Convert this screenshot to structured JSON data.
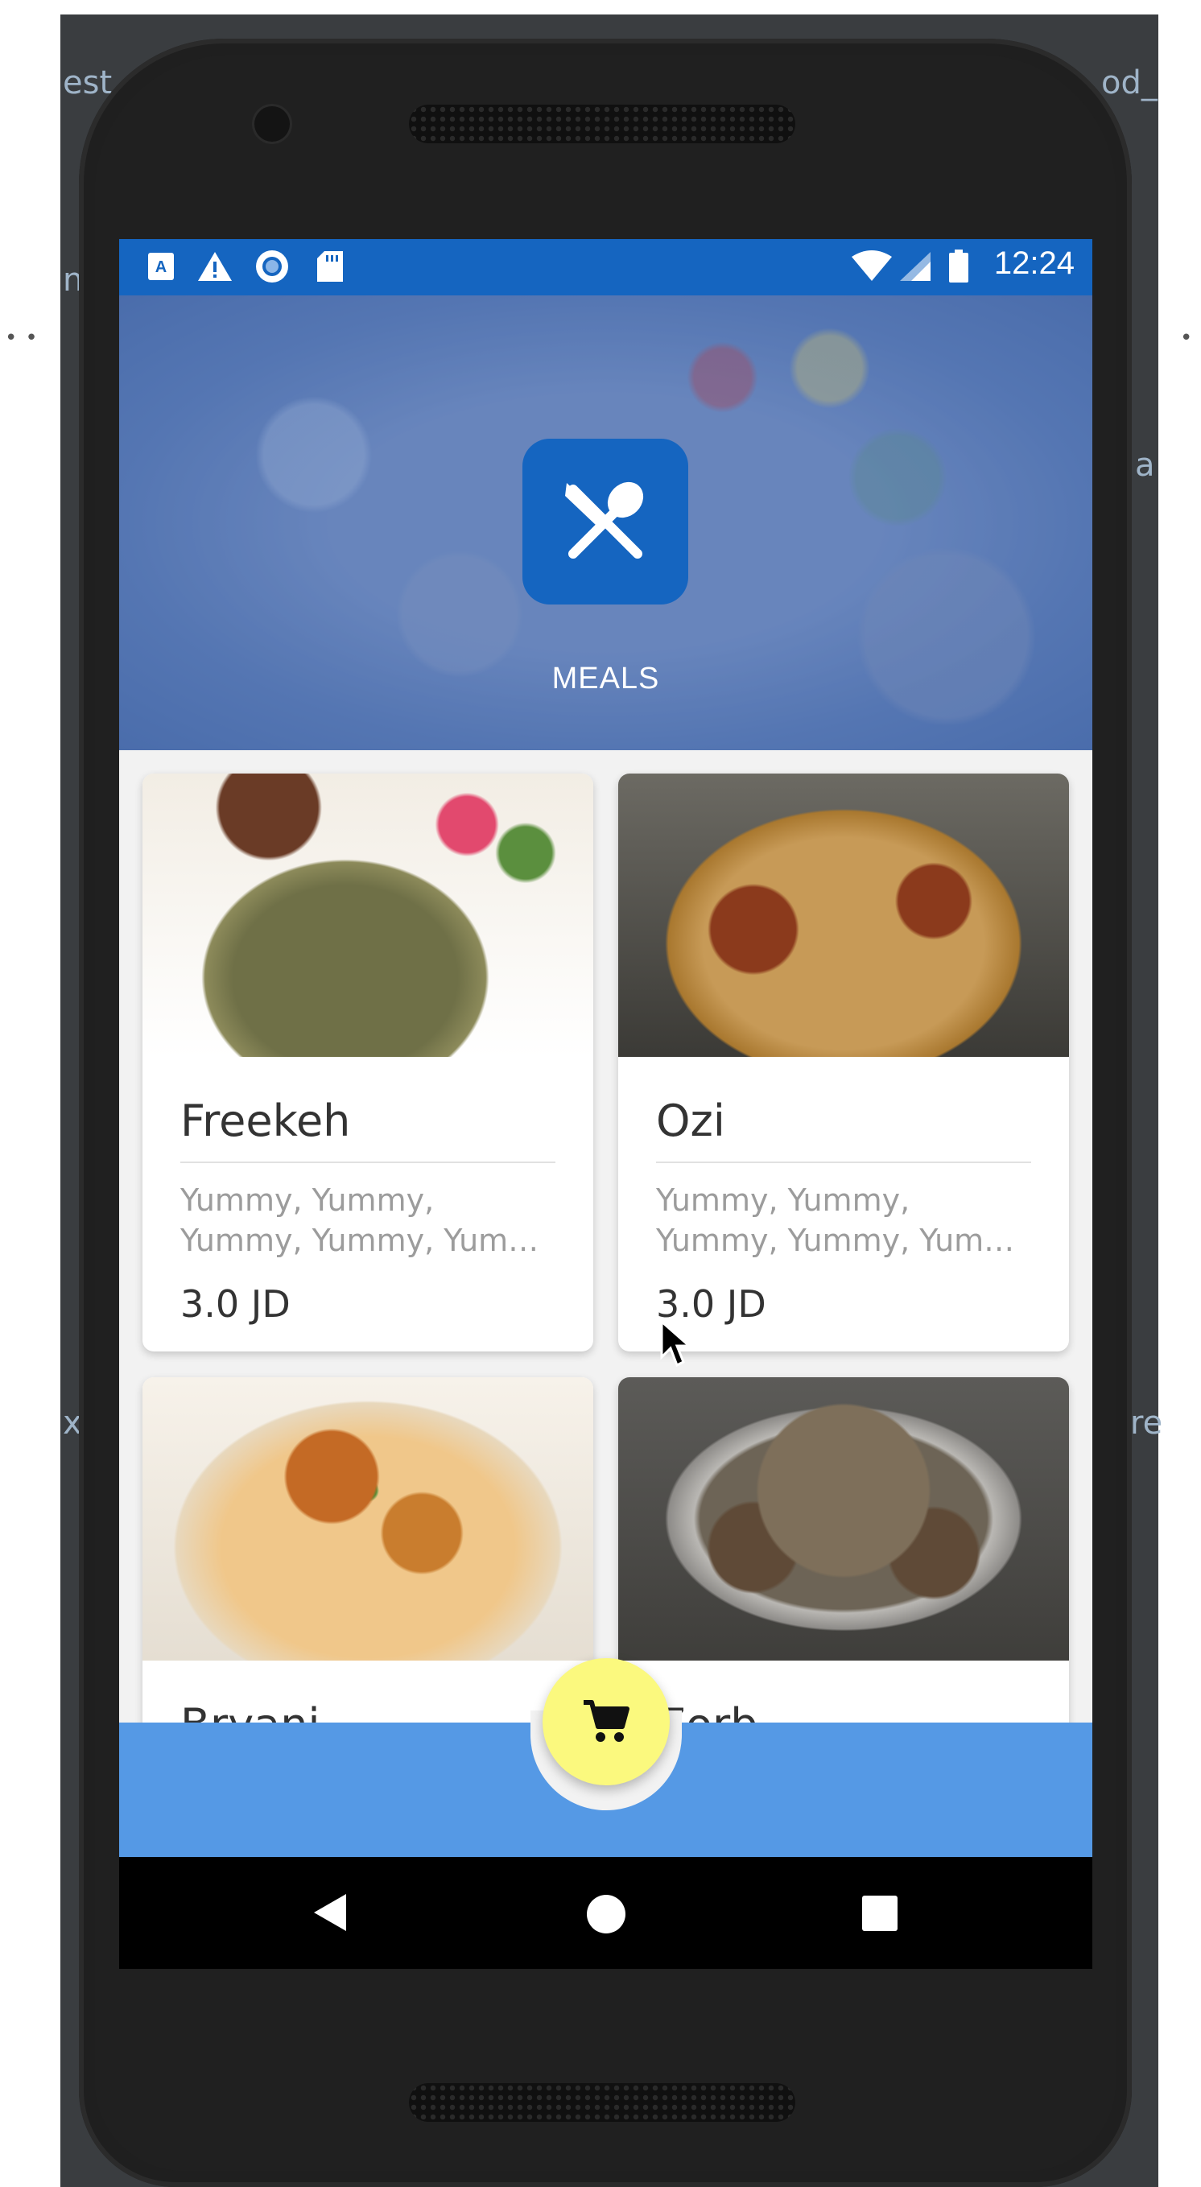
{
  "ide": {
    "left_tab_fragment": "est",
    "right_tab_fragment": "od_",
    "left_mid_fragment": "x",
    "right_mid_fragment": "re",
    "right_upper_fragment": "a",
    "left_small_fragment": "n"
  },
  "status_bar": {
    "time": "12:24",
    "icons": [
      "a-keyboard-icon",
      "warning-icon",
      "record-icon",
      "sd-card-icon",
      "wifi-icon",
      "signal-icon",
      "battery-icon"
    ],
    "background": "#1565c0"
  },
  "hero": {
    "title": "MEALS",
    "icon": "utensils-icon",
    "badge_color": "#1565c0"
  },
  "meals": [
    {
      "name": "Freekeh",
      "description": "Yummy, Yummy, Yummy, Yummy, Yum…",
      "price": "3.0 JD"
    },
    {
      "name": "Ozi",
      "description": "Yummy, Yummy, Yummy, Yummy, Yum…",
      "price": "3.0 JD"
    },
    {
      "name": "Bryani",
      "description": "",
      "price": ""
    },
    {
      "name": "Zorb",
      "description": "",
      "price": ""
    }
  ],
  "bottom_bar": {
    "color": "#5599e5",
    "fab_icon": "cart-icon",
    "fab_color": "#fbf97e"
  },
  "nav": {
    "items": [
      "back-icon",
      "home-icon",
      "recents-icon"
    ]
  }
}
